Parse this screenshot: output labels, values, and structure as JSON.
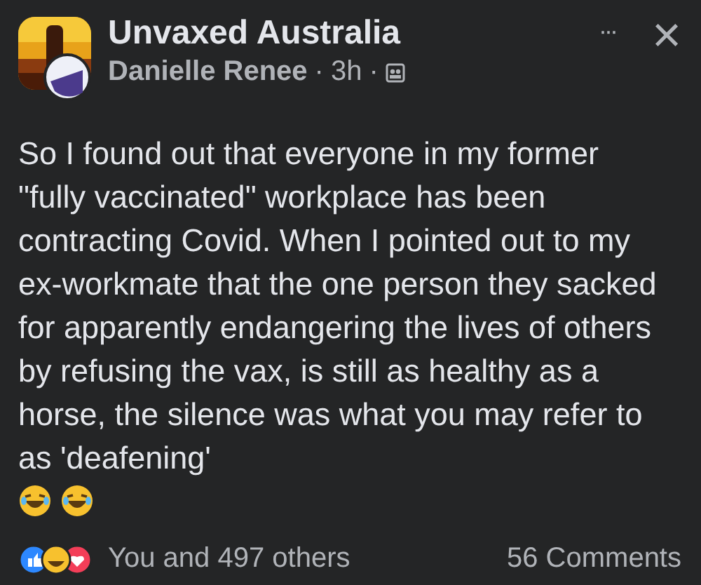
{
  "post": {
    "group_name": "Unvaxed Australia",
    "author": "Danielle Renee",
    "separator_1": "·",
    "time": "3h",
    "separator_2": "·",
    "more": "···",
    "close": "×",
    "text": "So I found out that everyone in my former \"fully vaccinated\" workplace has been contracting Covid.  When I pointed out to my ex-workmate that the one person they sacked for apparently endangering the lives of others by refusing the vax, is still as healthy as a horse, the silence was what you may refer to as 'deafening'"
  },
  "footer": {
    "reactions": "You and 497 others",
    "comments": "56 Comments"
  }
}
